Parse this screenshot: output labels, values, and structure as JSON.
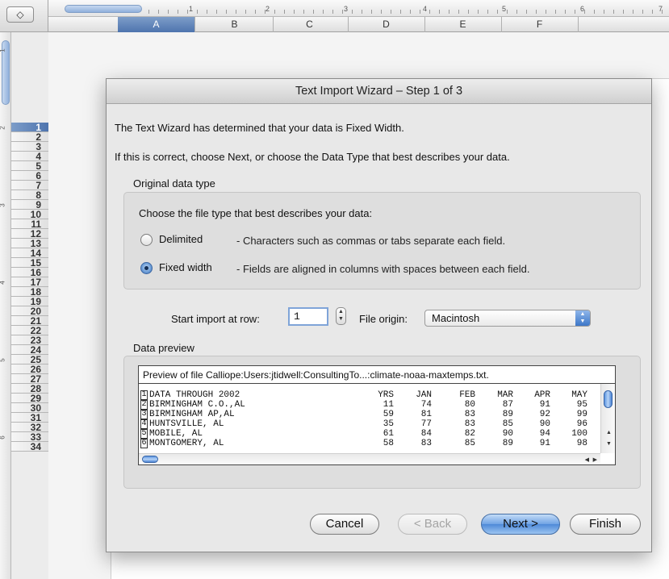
{
  "sheet": {
    "corner_glyph": "◇",
    "ruler_numbers": [
      "1",
      "2",
      "3",
      "4",
      "5",
      "6",
      "7"
    ],
    "columns": [
      "A",
      "B",
      "C",
      "D",
      "E",
      "F"
    ],
    "rows": [
      "1",
      "2",
      "3",
      "4",
      "5",
      "6",
      "7",
      "8",
      "9",
      "10",
      "11",
      "12",
      "13",
      "14",
      "15",
      "16",
      "17",
      "18",
      "19",
      "20",
      "21",
      "22",
      "23",
      "24",
      "25",
      "26",
      "27",
      "28",
      "29",
      "30",
      "31",
      "32",
      "33",
      "34"
    ],
    "vruler_numbers": [
      "1",
      "2",
      "3",
      "4",
      "5",
      "6"
    ]
  },
  "dialog": {
    "title": "Text Import Wizard – Step 1 of 3",
    "intro": "The Text Wizard has determined that your data is Fixed Width.",
    "instruction": "If this is correct, choose Next, or choose the Data Type that best describes your data.",
    "original_type": {
      "label": "Original data type",
      "prompt": "Choose the file type that best describes your data:",
      "options": [
        {
          "label": "Delimited",
          "desc": "- Characters such as commas or tabs separate each field.",
          "checked": false
        },
        {
          "label": "Fixed width",
          "desc": "- Fields are aligned in columns with spaces between each field.",
          "checked": true
        }
      ]
    },
    "start_row_label": "Start import at row:",
    "start_row_value": "1",
    "file_origin_label": "File origin:",
    "file_origin_value": "Macintosh",
    "preview": {
      "label": "Data preview",
      "title": "Preview of file Calliope:Users:jtidwell:ConsultingTo...:climate-noaa-maxtemps.txt.",
      "rows": [
        {
          "num": "1",
          "name": "DATA THROUGH 2002",
          "cells": [
            "YRS",
            "JAN",
            "FEB",
            "MAR",
            "APR",
            "MAY"
          ]
        },
        {
          "num": "2",
          "name": "BIRMINGHAM C.O.,AL",
          "cells": [
            "11",
            "74",
            "80",
            "87",
            "91",
            "95"
          ]
        },
        {
          "num": "3",
          "name": "BIRMINGHAM AP,AL",
          "cells": [
            "59",
            "81",
            "83",
            "89",
            "92",
            "99"
          ]
        },
        {
          "num": "4",
          "name": "HUNTSVILLE, AL",
          "cells": [
            "35",
            "77",
            "83",
            "85",
            "90",
            "96"
          ]
        },
        {
          "num": "5",
          "name": "MOBILE, AL",
          "cells": [
            "61",
            "84",
            "82",
            "90",
            "94",
            "100"
          ]
        },
        {
          "num": "6",
          "name": "MONTGOMERY, AL",
          "cells": [
            "58",
            "83",
            "85",
            "89",
            "91",
            "98"
          ]
        }
      ]
    },
    "buttons": {
      "cancel": "Cancel",
      "back": "< Back",
      "next": "Next >",
      "finish": "Finish"
    }
  }
}
